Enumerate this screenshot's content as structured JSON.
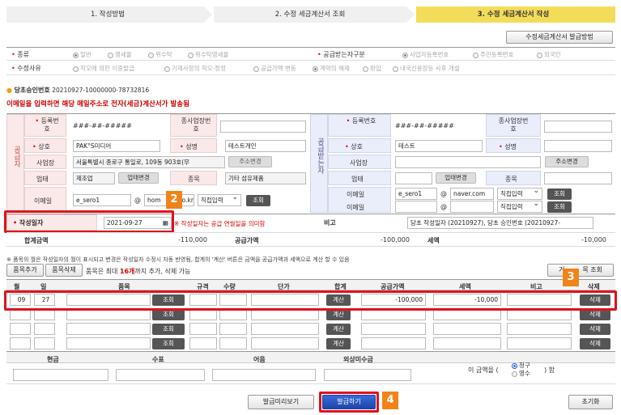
{
  "steps": [
    "1. 작성방법",
    "2. 수정 세금계산서 조회",
    "3. 수정 세금계산서 작성"
  ],
  "toolbar": {
    "guide_button": "수정세금계산서 발급방법"
  },
  "type_row": {
    "label": "종류",
    "options": [
      "일반",
      "영세율",
      "위수탁",
      "위수탁영세율"
    ],
    "receiver_label": "공급받는자구분",
    "receiver_options": [
      "사업자등록번호",
      "주민등록번호",
      "외국인"
    ]
  },
  "reason_row": {
    "label": "수정사유",
    "options": [
      "착오에 의한 이중발급",
      "기재사항의 착오·정정",
      "공급가액 변동",
      "계약의 해제",
      "환입",
      "내국신용장등 사후 개설"
    ]
  },
  "approval": {
    "label": "당초승인번호",
    "value": "20210927-10000000-78732816"
  },
  "notice": "이메일을 입력하면 해당 메일주소로 전자(세금)계산서가 발송됨",
  "supplier": {
    "side_label": "공급자",
    "reg_label": "등록번호",
    "reg_value": "###-##-#####",
    "sub_label": "종사업장번호",
    "name_label": "상호",
    "name_value": "PAK°S미디어",
    "rep_label": "성명",
    "rep_value": "테스트개인",
    "addr_label": "사업장",
    "addr_value": "서울특별시 종로구 통일로, 109동 903호(무",
    "addr_button": "주소변경",
    "biz_label": "업태",
    "biz_value": "제조업",
    "biz_button": "업태변경",
    "item_label": "종목",
    "item_value": "기타 섬유제품 ",
    "email_label": "이메일",
    "email_id": "e_sero1",
    "email_at": "@",
    "email_domain": "hom",
    "email_domain_tail": "o.kr",
    "email_select": "직접입력",
    "email_button": "조회"
  },
  "receiver": {
    "side_label": "공급받는자",
    "reg_label": "등록번호",
    "reg_value": "###-##-#####",
    "sub_label": "종사업장번호",
    "name_label": "상호",
    "name_value": "테스트",
    "rep_label": "성명",
    "rep_value": "",
    "addr_label": "사업장",
    "addr_button": "주소변경",
    "biz_label": "업태",
    "biz_button": "업태변경",
    "item_label": "종목",
    "email_label": "이메일",
    "email1_id": "e_sero1",
    "email1_at": "@",
    "email1_domain": "naver.com",
    "email1_select": "직접입력",
    "email1_button": "조회",
    "email2_at": "@",
    "email2_select": "직접입력",
    "email2_button": "조회"
  },
  "date_row": {
    "label": "작성일자",
    "value": "2021-09-27",
    "hint": "※ 작성일자는 공급 연월일을 의미함",
    "note_label": "비고",
    "note_value": "당초 작성일자 (20210927), 당초 승인번호 (20210927-"
  },
  "totals": {
    "total_label": "합계금액",
    "total_value": "-110,000",
    "supply_label": "공급가액",
    "supply_value": "-100,000",
    "tax_label": "세액",
    "tax_value": "-10,000"
  },
  "items_notice": "※ 품목의 월은 작성일자의 월이 표시되고 변경은 작성일자 수정시 자동 반영됨, 합계의 '계산' 버튼은 금액을 공급가액과 세액으로 계산 할 수 있음",
  "items_toolbar": {
    "add": "품목추가",
    "delete": "품목삭제",
    "limit_pre": "품목은 최대 ",
    "limit_num": "16개",
    "limit_post": "까지 추가, 삭제 가능",
    "lookup": "거래품목 조회",
    "lookup_visible": "거",
    "lookup_tail": "목 조회"
  },
  "items_table": {
    "headers": [
      "월",
      "일",
      "품목",
      "규격",
      "수량",
      "단가",
      "합계",
      "공급가액",
      "세액",
      "비고",
      "삭제"
    ],
    "rows": [
      {
        "month": "09",
        "day": "27",
        "search": "조회",
        "calc": "계산",
        "supply": "-100,000",
        "tax": "-10,000",
        "delete": "삭제"
      },
      {
        "month": "",
        "day": "",
        "search": "조회",
        "calc": "계산",
        "supply": "",
        "tax": "",
        "delete": "삭제"
      },
      {
        "month": "",
        "day": "",
        "search": "조회",
        "calc": "계산",
        "supply": "",
        "tax": "",
        "delete": "삭제"
      },
      {
        "month": "",
        "day": "",
        "search": "조회",
        "calc": "계산",
        "supply": "",
        "tax": "",
        "delete": "삭제"
      }
    ]
  },
  "payment": {
    "headers": [
      "현금",
      "수표",
      "어음",
      "외상미수금"
    ],
    "amount_pre": "이 금액을 (",
    "claim": "청구",
    "receipt": "영수",
    "amount_post": ") 함"
  },
  "footer": {
    "preview": "발급미리보기",
    "issue": "발급하기",
    "reset": "초기화"
  },
  "badges": [
    "2",
    "3",
    "4"
  ],
  "colors": {
    "highlight": "#e0121b",
    "badge": "#f08418",
    "active_step": "#f3dc5a"
  }
}
